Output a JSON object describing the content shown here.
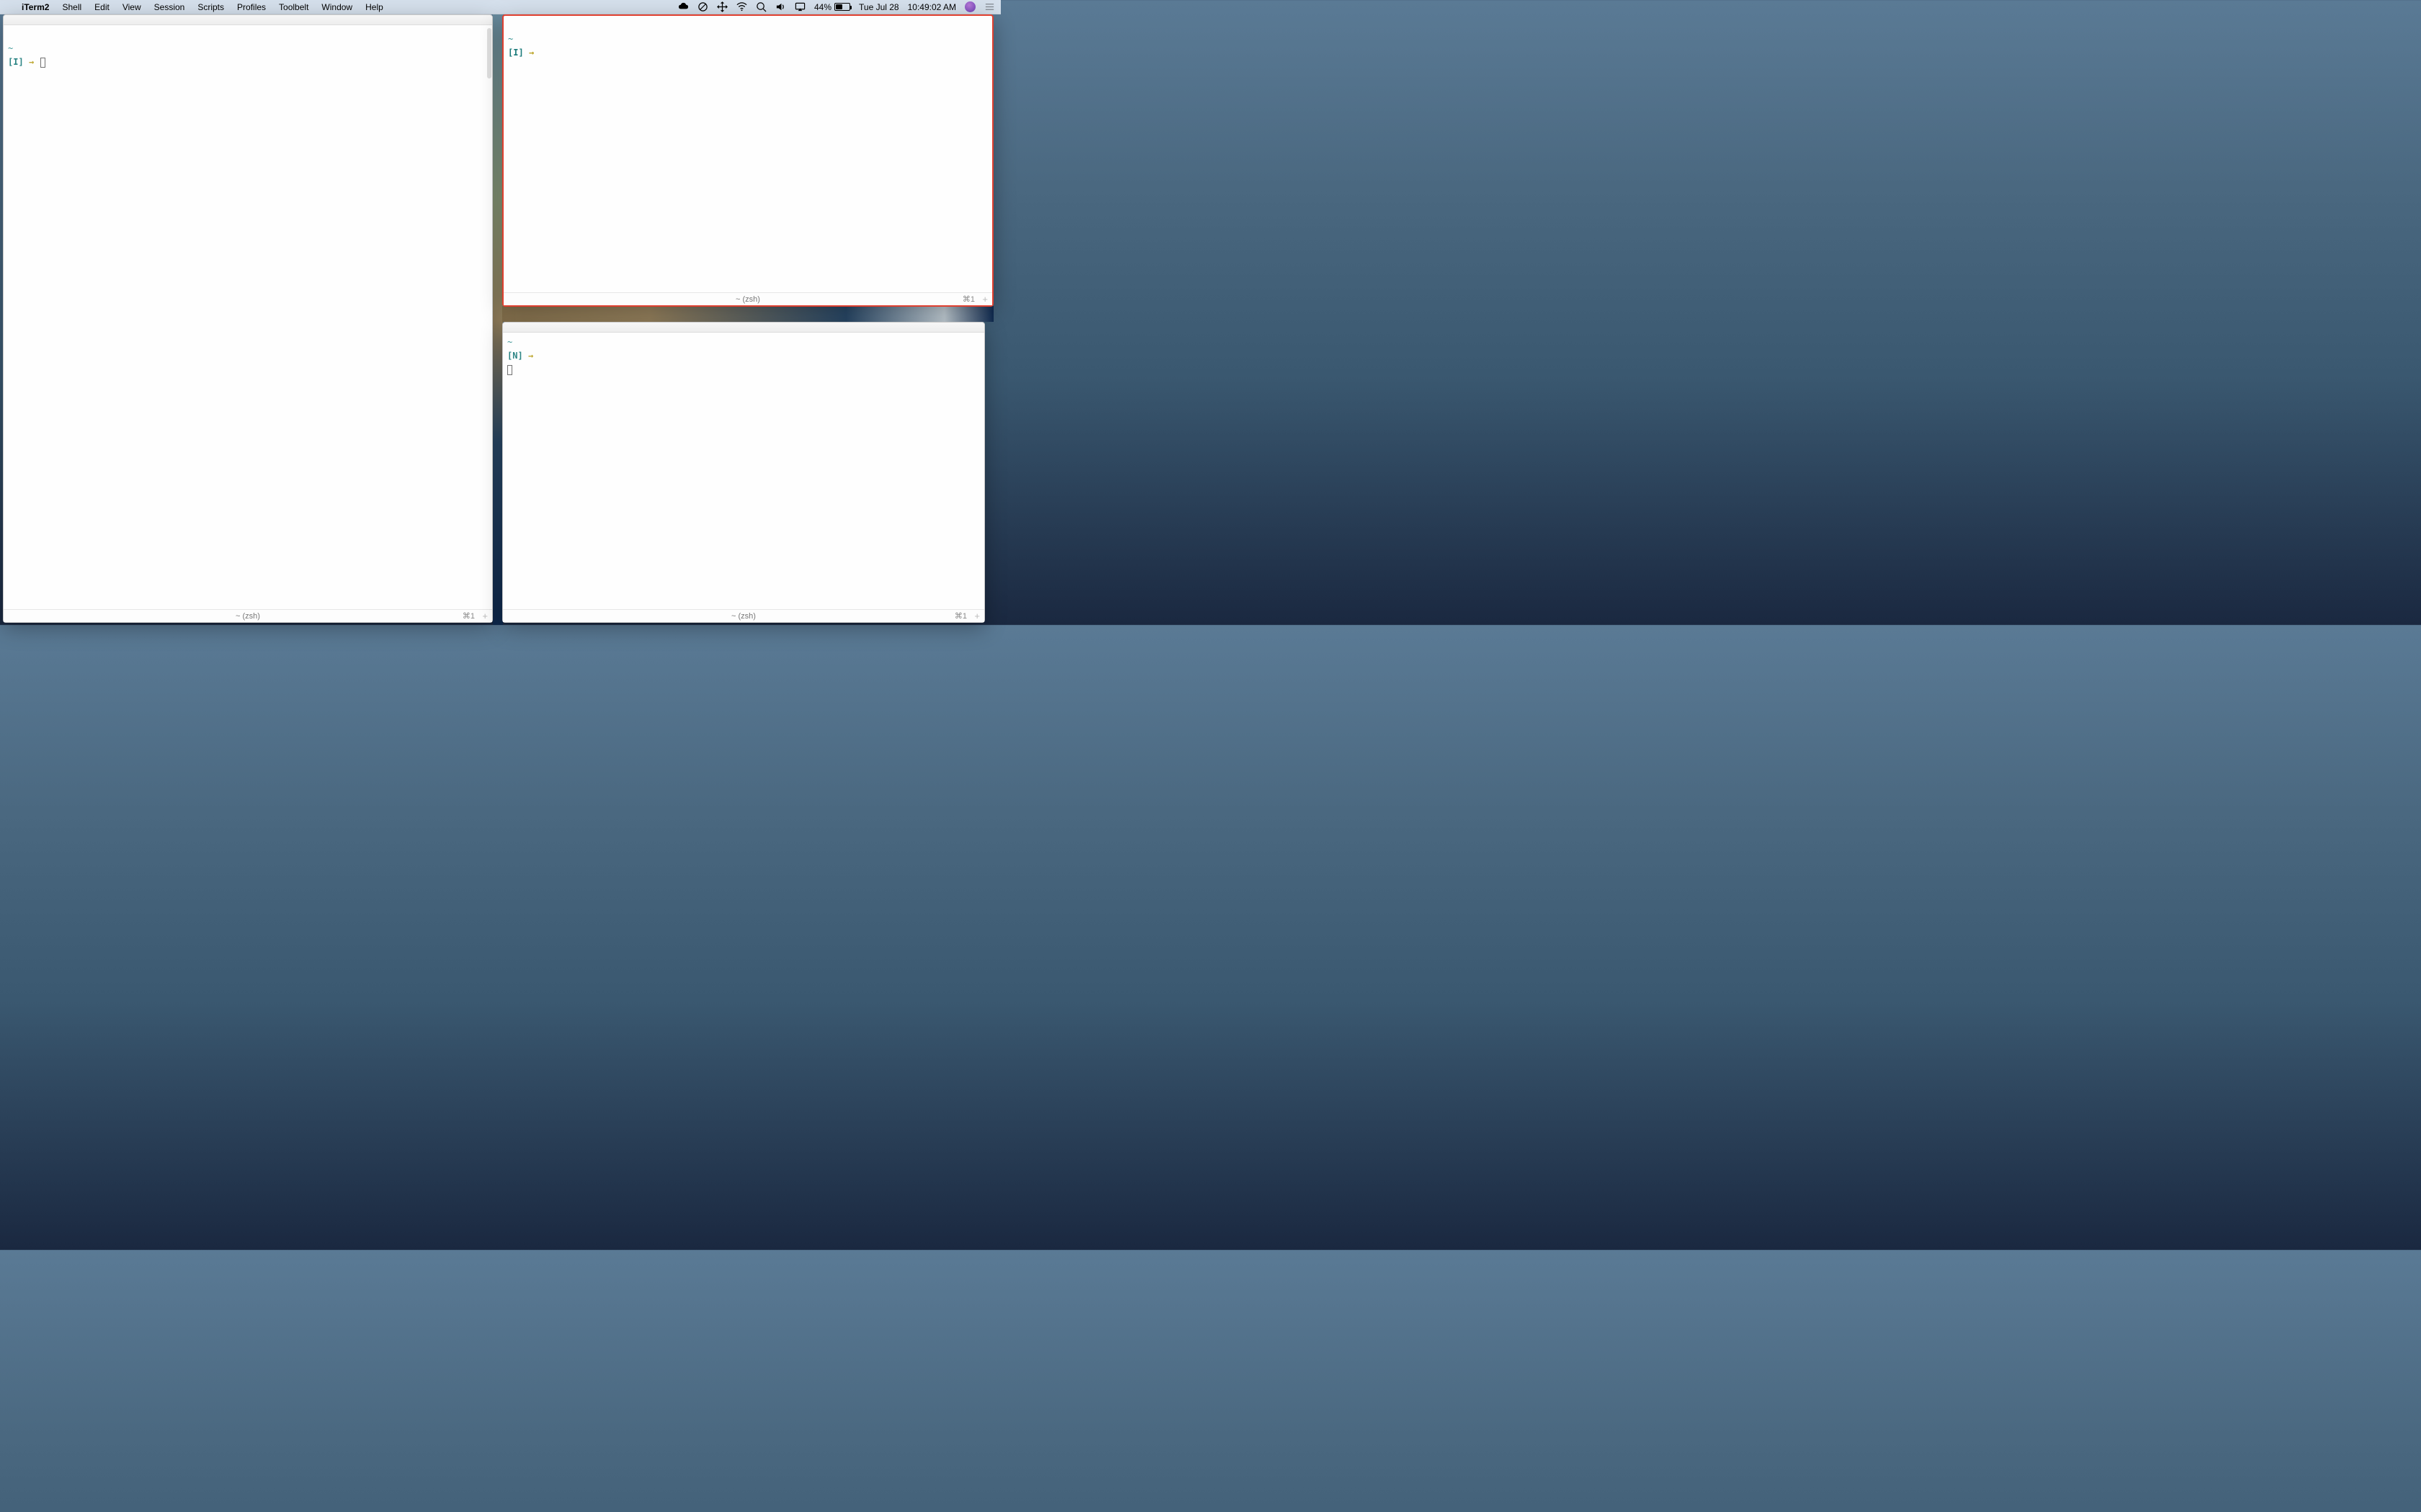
{
  "menubar": {
    "app": "iTerm2",
    "items": [
      "Shell",
      "Edit",
      "View",
      "Session",
      "Scripts",
      "Profiles",
      "Toolbelt",
      "Window",
      "Help"
    ]
  },
  "status": {
    "battery_percent": "44%",
    "date": "Tue Jul 28",
    "time": "10:49:02 AM"
  },
  "panes": {
    "left": {
      "cwd": "~",
      "mode": "I",
      "status_title": "~ (zsh)",
      "shortcut": "⌘1"
    },
    "top_right": {
      "cwd": "~",
      "mode": "I",
      "status_title": "~ (zsh)",
      "shortcut": "⌘1"
    },
    "bottom_right": {
      "cwd": "~",
      "mode": "N",
      "status_title": "~ (zsh)",
      "shortcut": "⌘1"
    }
  },
  "prompt_symbols": {
    "arrow": "→"
  }
}
